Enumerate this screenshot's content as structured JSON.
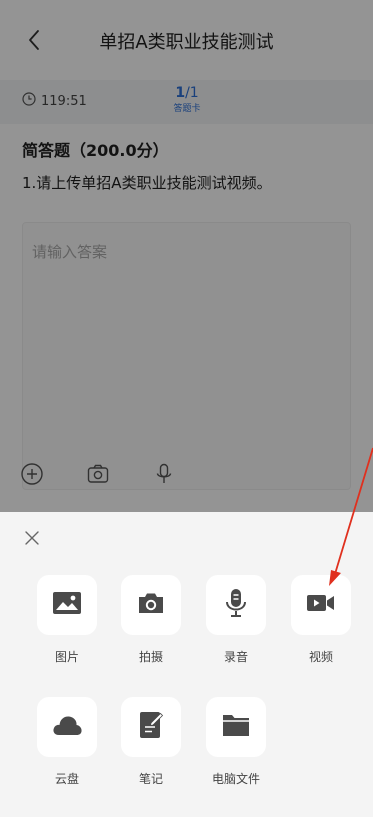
{
  "nav": {
    "title": "单招A类职业技能测试",
    "back_icon": "chevron-left-icon"
  },
  "info": {
    "timer": "119:51",
    "progress_current": "1",
    "progress_total": "/1",
    "answer_card": "答题卡"
  },
  "question": {
    "type_label": "简答题（200.0分）",
    "text": "1.请上传单招A类职业技能测试视频。"
  },
  "answer": {
    "placeholder": "请输入答案"
  },
  "sheet": {
    "items": [
      {
        "label": "图片",
        "icon": "image-icon"
      },
      {
        "label": "拍摄",
        "icon": "camera-icon"
      },
      {
        "label": "录音",
        "icon": "microphone-icon"
      },
      {
        "label": "视频",
        "icon": "video-icon"
      },
      {
        "label": "云盘",
        "icon": "cloud-icon"
      },
      {
        "label": "笔记",
        "icon": "note-icon"
      },
      {
        "label": "电脑文件",
        "icon": "folder-icon"
      }
    ]
  },
  "colors": {
    "accent": "#2b6fd6",
    "annotation_arrow": "#e0301e",
    "icon_dark": "#4a4a4a"
  }
}
